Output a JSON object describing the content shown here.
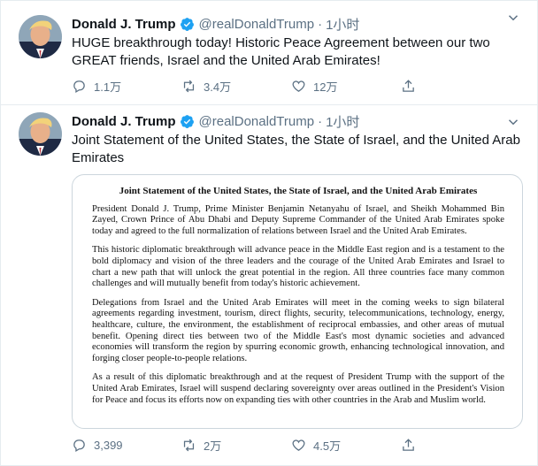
{
  "tweets": [
    {
      "name": "Donald J. Trump",
      "handle": "@realDonaldTrump",
      "separator": "·",
      "time": "1小时",
      "text": "HUGE breakthrough today! Historic Peace Agreement between our two GREAT friends, Israel and the United Arab Emirates!",
      "replies": "1.1万",
      "retweets": "3.4万",
      "likes": "12万"
    },
    {
      "name": "Donald J. Trump",
      "handle": "@realDonaldTrump",
      "separator": "·",
      "time": "1小时",
      "text": "Joint Statement of the United States, the State of Israel, and the United Arab Emirates",
      "replies": "3,399",
      "retweets": "2万",
      "likes": "4.5万",
      "document": {
        "title": "Joint Statement of the United States, the State of Israel, and the United Arab Emirates",
        "paragraphs": [
          "President Donald J. Trump, Prime Minister Benjamin Netanyahu of Israel, and Sheikh Mohammed Bin Zayed, Crown Prince of Abu Dhabi and Deputy Supreme Commander of the United Arab Emirates spoke today and agreed to the full normalization of relations between Israel and the United Arab Emirates.",
          "This historic diplomatic breakthrough will advance peace in the Middle East region and is a testament to the bold diplomacy and vision of the three leaders and the courage of the United Arab Emirates and Israel to chart a new path that will unlock the great potential in the region. All three countries face many common challenges and will mutually benefit from today's historic achievement.",
          "Delegations from Israel and the United Arab Emirates will meet in the coming weeks to sign bilateral agreements regarding investment, tourism, direct flights, security, telecommunications, technology, energy, healthcare, culture, the environment, the establishment of reciprocal embassies, and other areas of mutual benefit. Opening direct ties between two of the Middle East's most dynamic societies and advanced economies will transform the region by spurring economic growth, enhancing technological innovation, and forging closer people-to-people relations.",
          "As a result of this diplomatic breakthrough and at the request of President Trump with the support of the United Arab Emirates, Israel will suspend declaring sovereignty over areas outlined in the President's Vision for Peace and focus its efforts now on expanding ties with other countries in the Arab and Muslim world."
        ]
      }
    }
  ],
  "colors": {
    "verified": "#1da1f2",
    "secondary_text": "#5b7083",
    "divider": "#e6ecf0"
  },
  "icons": {
    "verified": "verified-badge-icon",
    "more": "chevron-down-icon",
    "reply": "reply-icon",
    "retweet": "retweet-icon",
    "like": "heart-icon",
    "share": "share-icon"
  }
}
